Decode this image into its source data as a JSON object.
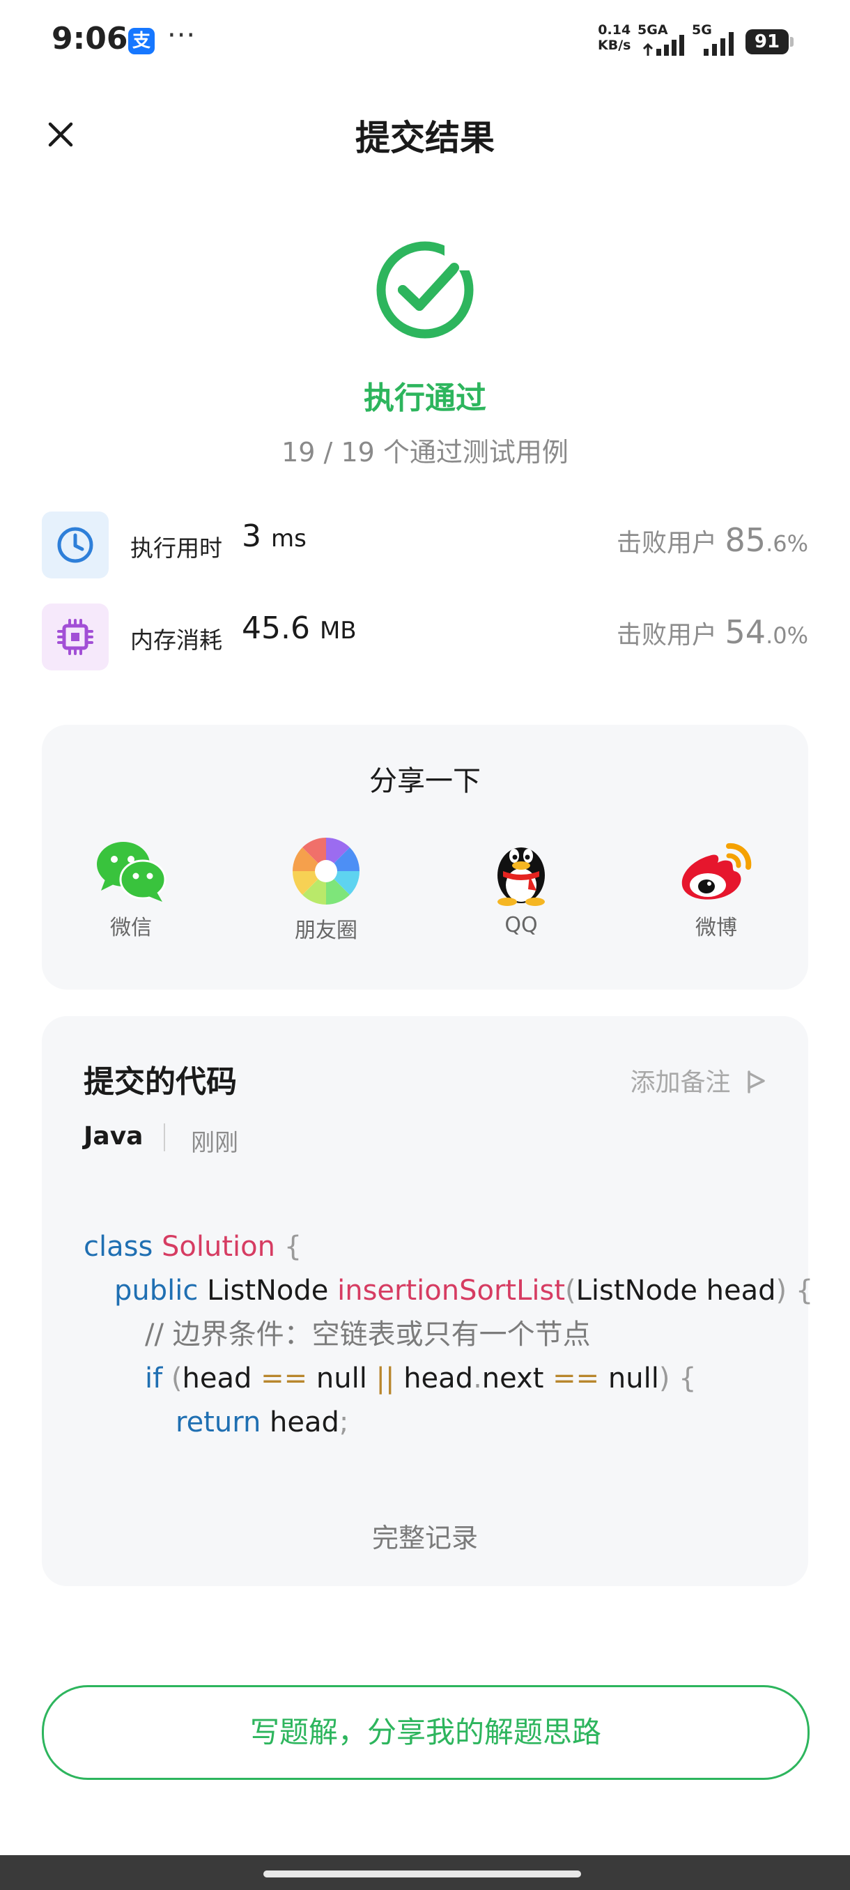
{
  "status_bar": {
    "time": "9:06",
    "app_badge": "支",
    "more": "···",
    "speed_value": "0.14",
    "speed_unit": "KB/s",
    "net1": "5GA",
    "net2": "5G",
    "battery": "91"
  },
  "header": {
    "title": "提交结果"
  },
  "result": {
    "status": "执行通过",
    "cases": "19 / 19 个通过测试用例",
    "accent_color": "#2db55d"
  },
  "stats": {
    "runtime": {
      "label": "执行用时",
      "value": "3",
      "unit": "ms",
      "beat_label": "击败用户",
      "beat_int": "85",
      "beat_frac": ".6%",
      "icon": "clock-icon"
    },
    "memory": {
      "label": "内存消耗",
      "value": "45.6",
      "unit": "MB",
      "beat_label": "击败用户",
      "beat_int": "54",
      "beat_frac": ".0%",
      "icon": "chip-icon"
    }
  },
  "share": {
    "title": "分享一下",
    "items": [
      {
        "label": "微信",
        "icon": "wechat-icon"
      },
      {
        "label": "朋友圈",
        "icon": "moments-icon"
      },
      {
        "label": "QQ",
        "icon": "qq-icon"
      },
      {
        "label": "微博",
        "icon": "weibo-icon"
      }
    ]
  },
  "code_card": {
    "title": "提交的代码",
    "add_note": "添加备注",
    "language": "Java",
    "time": "刚刚",
    "lines": [
      {
        "kw": "class",
        "cls": "Solution",
        "rest": "{"
      },
      {
        "kw": "public",
        "type": "ListNode",
        "fn": "insertionSortList",
        "args": "ListNode head",
        "rest": "{"
      },
      {
        "comment": "// 边界条件：空链表或只有一个节点"
      },
      {
        "kw": "if",
        "a": "head",
        "op1": "==",
        "b": "null",
        "op2": "||",
        "c": "head",
        "dot": ".",
        "d": "next",
        "op3": "==",
        "e": "null",
        "rest": "{"
      },
      {
        "kw": "return",
        "a": "head",
        "rest": ";"
      }
    ],
    "full_record": "完整记录"
  },
  "bottom": {
    "solution_button": "写题解，分享我的解题思路"
  }
}
